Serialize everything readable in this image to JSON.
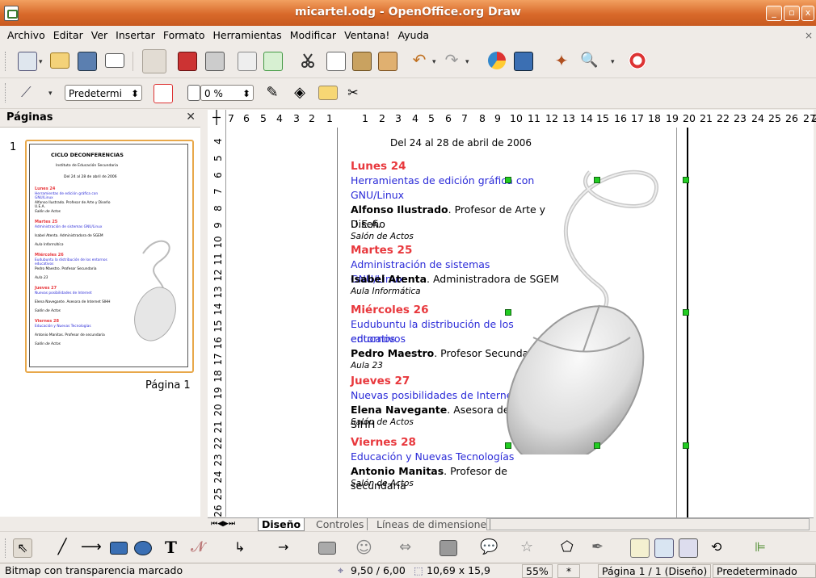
{
  "window": {
    "title": "micartel.odg - OpenOffice.org Draw"
  },
  "menu": [
    "Archivo",
    "Editar",
    "Ver",
    "Insertar",
    "Formato",
    "Herramientas",
    "Modificar",
    "Ventana!",
    "Ayuda"
  ],
  "toolbar2": {
    "style_value": "Predetermi",
    "transparency_value": "0 %"
  },
  "pages_panel": {
    "title": "Páginas",
    "page_number": "1",
    "page_label": "Página 1"
  },
  "thumbnail": {
    "title": "CICLO DECONFERENCIAS",
    "subtitle": "Instituto de Educación Secundaria",
    "date": "Del 24 al 28 de abril de 2006",
    "days": [
      {
        "day": "Lunes 24",
        "topic": "Herramientas de edición gráfica con GNU/Linux",
        "who": "Alfonso Ilustrado. Profesor de Arte y Diseño U.E.A.",
        "place": "Salón de Actos"
      },
      {
        "day": "Martes 25",
        "topic": "Administración de sistemas GNU/Linux",
        "who": "Isabel Atenta. Administradora de SGEM",
        "place": "Aula Informática"
      },
      {
        "day": "Miércoles 26",
        "topic": "Eudubuntu la distribución de los entornos educativos",
        "who": "Pedro Maestro. Profesor Secundaria",
        "place": "Aula 23"
      },
      {
        "day": "Jueves 27",
        "topic": "Nuevas posibilidades de Internet",
        "who": "Elena Navegante. Asesora de Internet SIHH",
        "place": "Salón de Actos"
      },
      {
        "day": "Viernes 28",
        "topic": "Educación y Nuevas Tecnologías",
        "who": "Antonio Manitas. Profesor de secundaria",
        "place": "Salón de Actos"
      }
    ]
  },
  "hruler": [
    "7",
    "6",
    "5",
    "4",
    "3",
    "2",
    "1",
    "1",
    "2",
    "3",
    "4",
    "5",
    "6",
    "7",
    "8",
    "9",
    "10",
    "11",
    "12",
    "13",
    "14",
    "15",
    "16",
    "17",
    "18",
    "19",
    "20",
    "21",
    "22",
    "23",
    "24",
    "25",
    "26",
    "27",
    "2"
  ],
  "vruler": [
    "4",
    "5",
    "6",
    "7",
    "8",
    "9",
    "10",
    "11",
    "12",
    "13",
    "14",
    "15",
    "16",
    "17",
    "18",
    "19",
    "20",
    "21",
    "22",
    "23",
    "24",
    "25",
    "26"
  ],
  "document": {
    "date": "Del 24 al 28 de abril de 2006",
    "days": [
      {
        "day": "Lunes 24",
        "topic_line1": "Herramientas de edición gráfica con",
        "topic_line2": "GNU/Linux",
        "who_bold": "Alfonso Ilustrado",
        "who_rest": ". Profesor de Arte y Diseño",
        "who_line2": "U.E.A.",
        "place": "Salón de Actos"
      },
      {
        "day": "Martes 25",
        "topic_line1": "Administración de sistemas GNU/Linux",
        "who_bold": "Isabel Atenta",
        "who_rest": ". Administradora de SGEM",
        "place": "Aula Informática"
      },
      {
        "day": "Miércoles 26",
        "topic_line1": "Eudubuntu la distribución de los entornos",
        "topic_line2": "educativos",
        "who_bold": "Pedro Maestro",
        "who_rest": ". Profesor Secundaria",
        "place": "Aula 23"
      },
      {
        "day": "Jueves 27",
        "topic_line1": "Nuevas posibilidades de Internet",
        "who_bold": "Elena Navegante",
        "who_rest": ". Asesora de Internet SIHH",
        "place": "Salón de Actos"
      },
      {
        "day": "Viernes 28",
        "topic_line1": "Educación y Nuevas Tecnologías",
        "who_bold": "Antonio Manitas",
        "who_rest": ". Profesor de secundaria",
        "place": "Salón de Actos"
      }
    ]
  },
  "tabs": [
    "Diseño",
    "Controles",
    "Líneas de dimensione"
  ],
  "status": {
    "message": "Bitmap con transparencia marcado",
    "position": "9,50 / 6,00",
    "size": "10,69 x 15,9",
    "zoom": "55%",
    "modified": "*",
    "page_info": "Página 1 / 1 (Diseño)",
    "style": "Predeterminado"
  },
  "colors": {
    "day_red": "#e8383d",
    "topic_blue": "#2b2bd8",
    "title_orange": "#d8692a",
    "handle_green": "#22cc22"
  }
}
